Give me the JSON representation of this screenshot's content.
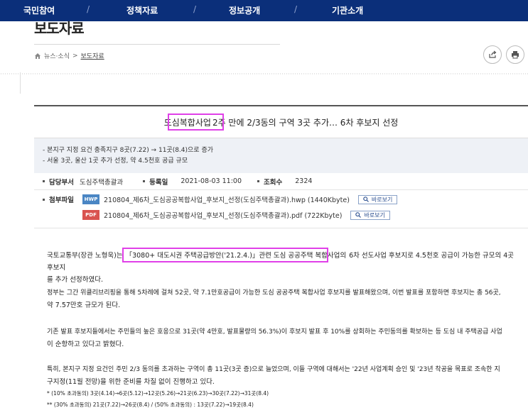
{
  "topnav": {
    "items": [
      "국민참여",
      "정책자료",
      "정보공개",
      "기관소개"
    ]
  },
  "page": {
    "title": "보도자료"
  },
  "breadcrumb": {
    "section": "뉴스·소식",
    "separator": ">",
    "current": "보도자료"
  },
  "article": {
    "title_highlight": "도심복합사업",
    "title_rest": "2주 만에 2/3동의 구역 3곳 추가… 6차 후보지 선정",
    "summary": [
      "- 본지구 지정 요건 충족지구 8곳(7.22) → 11곳(8.4)으로 증가",
      "- 서울 3곳, 울산 1곳 추가 선정, 약 4.5천호 공급 규모"
    ],
    "meta": {
      "dept_label": "담당부서",
      "dept_value": "도심주택총괄과",
      "date_label": "등록일",
      "date_value": "2021-08-03 11:00",
      "views_label": "조회수",
      "views_value": "2324"
    },
    "attachments": {
      "label": "첨부파일",
      "view_label": "바로보기",
      "files": [
        {
          "type": "HWP",
          "name": "210804_제6차_도심공공복합사업_후보지_선정(도심주택총괄과).hwp (1440Kbyte)"
        },
        {
          "type": "PDF",
          "name": "210804_제6차_도심공공복합사업_후보지_선정(도심주택총괄과).pdf (722Kbyte)"
        }
      ]
    },
    "body": {
      "p1_a": "국토교통부(장관 노형욱)는",
      "p1_highlight": "「3080+ 대도시권 주택공급방안('21.2.4.)」관련 도심 공공주택 복합사업의",
      "p1_b": "6차 선도사업 후보지로 4.5천호 공급이 가능한 규모의 4곳 후보지",
      "p1_c": "를 추가 선정하였다.",
      "p2_a": "정부는 그간 위클리브리핑을 통해 5차례에 걸쳐 52곳, 약 7.1만호공급이 가능한 도심 공공주택 복합사업 후보지를 발표해왔으며, 이번 발표를 포함하면 후보지는 총 56곳,",
      "p2_b": "약 7.57만호 규모가 된다.",
      "p3_a": "기존 발표 후보지들에서는 주민들의 높은 호응으로 31곳(약 4만호, 발표물량의 56.3%)이 후보지 발표 후 10%를 상회하는 주민동의를 확보하는 등 도심 내 주택공급 사업",
      "p3_b": "이 순항하고 있다고 밝혔다.",
      "p4_a": "특히, 본지구 지정 요건인 주민 2/3 동의를 초과하는 구역이 총 11곳(3곳 증)으로 늘었으며, 이들 구역에 대해서는 '22년 사업계획 승인 및 '23년 착공을 목표로 조속한 지",
      "p4_b": "구지정(11월 전망)을 위한 준비를 차질 없이 진행하고 있다.",
      "note1": "* (10% 초과동의) 3곳(4.14)→6곳(5.12)→12곳(5.26)→21곳(6.23)→30곳(7.22)→31곳(8.4)",
      "note2": "** (30% 초과동의) 21곳(7.22)→26곳(8.4) / (50% 초과동의) : 13곳(7.22)→19곳(8.4)"
    }
  },
  "colors": {
    "nav_bg": "#0b2f7a",
    "highlight_box": "#e040e8",
    "summary_bg": "#eef1f6"
  }
}
